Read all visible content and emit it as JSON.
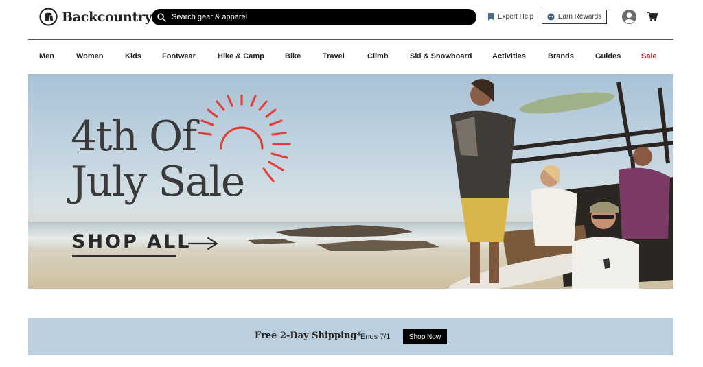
{
  "header": {
    "logo_text": "Backcountry",
    "search_placeholder": "Search gear & apparel",
    "expert_help": "Expert Help",
    "earn_rewards": "Earn Rewards"
  },
  "nav": {
    "items": [
      "Men",
      "Women",
      "Kids",
      "Footwear",
      "Hike & Camp",
      "Bike",
      "Travel",
      "Climb",
      "Ski & Snowboard",
      "Activities",
      "Brands",
      "Guides",
      "Sale"
    ]
  },
  "hero": {
    "title_line1": "4th Of",
    "title_line2": "July Sale",
    "cta": "SHOP ALL"
  },
  "promo": {
    "title": "Free 2-Day Shipping*",
    "ends": "Ends 7/1",
    "button": "Shop Now"
  },
  "colors": {
    "sale": "#c0161c",
    "sun": "#e0423a",
    "promo_bg": "#bccfde"
  }
}
